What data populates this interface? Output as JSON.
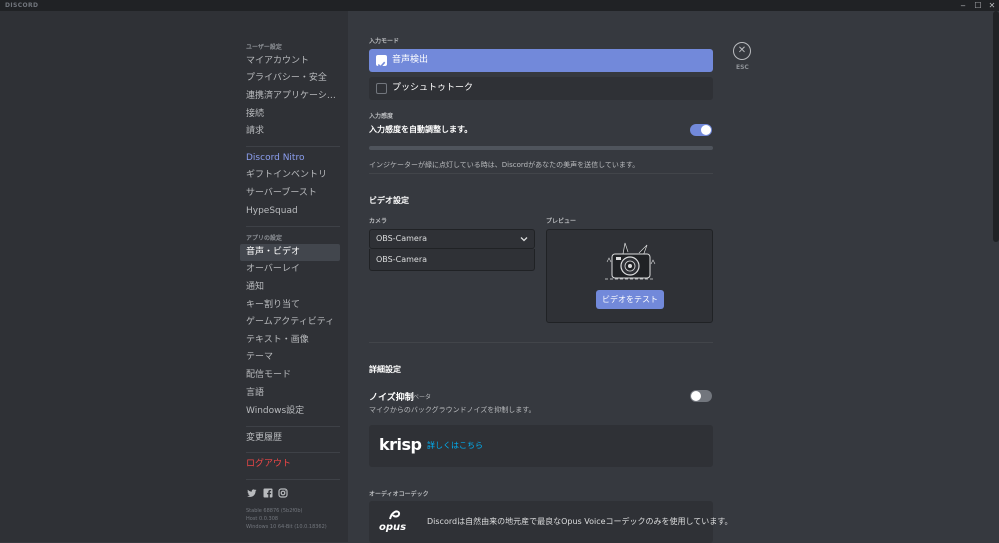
{
  "titlebar": {
    "app_name": "DISCORD",
    "minimize": "‒",
    "maximize": "☐",
    "close": "✕"
  },
  "sidebar": {
    "user_settings_header": "ユーザー設定",
    "user_items": [
      "マイアカウント",
      "プライバシー・安全",
      "連携済アプリケーショ...",
      "接続",
      "請求"
    ],
    "nitro_label": "Discord Nitro",
    "nitro_items": [
      "ギフトインベントリ",
      "サーバーブースト",
      "HypeSquad"
    ],
    "app_settings_header": "アプリの設定",
    "app_items": [
      "音声・ビデオ",
      "オーバーレイ",
      "通知",
      "キー割り当て",
      "ゲームアクティビティ",
      "テキスト・画像",
      "テーマ",
      "配信モード",
      "言語",
      "Windows設定"
    ],
    "changelog": "変更履歴",
    "logout": "ログアウト",
    "social_icons": [
      "twitter-icon",
      "facebook-icon",
      "instagram-icon"
    ],
    "version_lines": [
      "Stable 68876 (5b2f0b)",
      "Host 0.0.308",
      "Windows 10 64-Bit (10.0.18362)"
    ]
  },
  "content": {
    "input_mode_label": "入力モード",
    "voice_activity": "音声検出",
    "push_to_talk": "プッシュトゥトーク",
    "input_sensitivity_label": "入力感度",
    "auto_sensitivity": "入力感度を自動調整します。",
    "auto_sensitivity_on": true,
    "indicator_hint": "インジケーターが緑に点灯している時は、Discordがあなたの美声を送信しています。",
    "video_title": "ビデオ設定",
    "camera_label": "カメラ",
    "camera_value": "OBS-Camera",
    "camera_option": "OBS-Camera",
    "preview_label": "プレビュー",
    "test_video_button": "ビデオをテスト",
    "advanced_title": "詳細設定",
    "noise_suppression": "ノイズ抑制",
    "beta": "ベータ",
    "noise_desc": "マイクからのバックグラウンドノイズを抑制します。",
    "noise_on": false,
    "krisp_logo": "krisp",
    "krisp_link": "詳しくはこちら",
    "audio_codec_label": "オーディオコーデック",
    "opus_logo": "opus",
    "opus_text": "Discordは自然由来の地元産で最良なOpus Voiceコーデックのみを使用しています。",
    "esc_label": "ESC",
    "esc_symbol": "✕"
  },
  "colors": {
    "accent": "#7289da",
    "background": "#36393f",
    "sidebar": "#2f3136",
    "titlebar": "#202225",
    "logout": "#f04747",
    "link": "#00b0f4"
  }
}
